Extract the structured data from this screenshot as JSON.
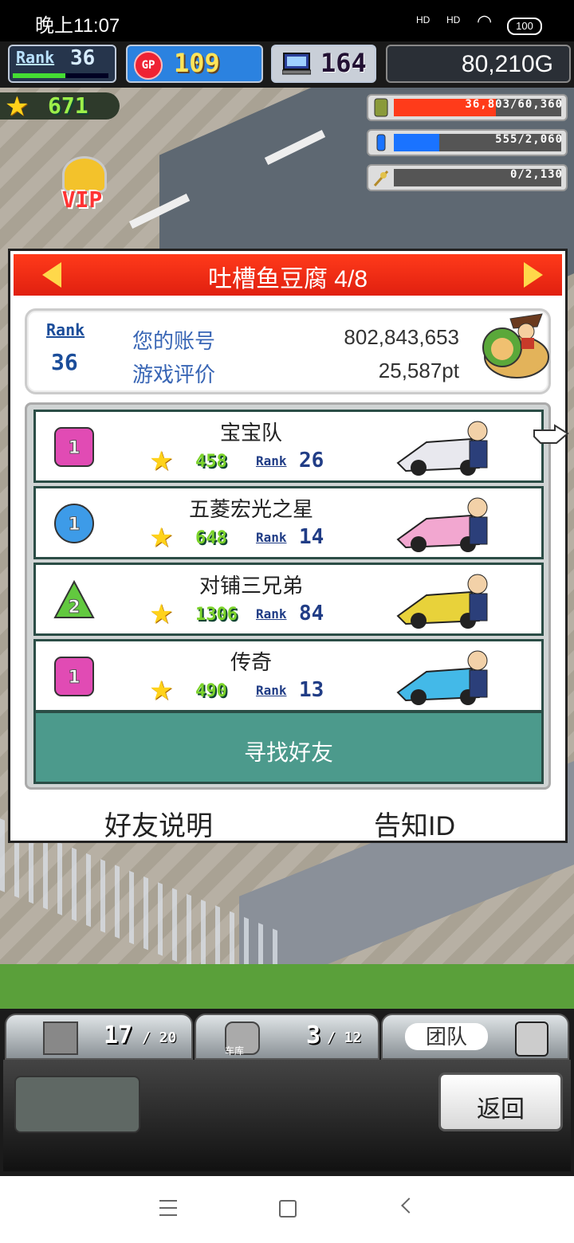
{
  "status_bar": {
    "time": "晚上11:07",
    "signal1": "HD",
    "signal2": "HD",
    "battery": "100"
  },
  "hud": {
    "rank_label": "Rank",
    "rank_value": "36",
    "rank_progress": 0.55,
    "gp_icon": "GP",
    "gp_value": "109",
    "pc_value": "164",
    "money": "80,210G"
  },
  "scene": {
    "score": "671",
    "vip": "VIP",
    "resources": [
      {
        "icon": "barrel-icon",
        "text": "36,803/60,360",
        "fill": 0.61,
        "color": "#ff3b1a"
      },
      {
        "icon": "bottle-icon",
        "text": "555/2,060",
        "fill": 0.27,
        "color": "#1a73ff"
      },
      {
        "icon": "wheat-icon",
        "text": "0/2,130",
        "fill": 0,
        "color": "#7ad13a"
      }
    ]
  },
  "dialog": {
    "title": "吐槽鱼豆腐 4/8",
    "account": {
      "rank_label": "Rank",
      "rank_value": "36",
      "id_label": "您的账号",
      "id_value": "802,843,653",
      "eval_label": "游戏评价",
      "eval_value": "25,587pt"
    },
    "friends": [
      {
        "badge": "1",
        "badge_shape": "square",
        "badge_color": "#e14bb4",
        "name": "宝宝队",
        "stars": "458",
        "rank_label": "Rank",
        "rank": "26",
        "car_color": "#e8e8ee"
      },
      {
        "badge": "1",
        "badge_shape": "circle",
        "badge_color": "#3d9be8",
        "name": "五菱宏光之星",
        "stars": "648",
        "rank_label": "Rank",
        "rank": "14",
        "car_color": "#f2a7d0"
      },
      {
        "badge": "2",
        "badge_shape": "triangle",
        "badge_color": "#62c93f",
        "name": "对铺三兄弟",
        "stars": "1306",
        "rank_label": "Rank",
        "rank": "84",
        "car_color": "#e8d23a"
      },
      {
        "badge": "1",
        "badge_shape": "square",
        "badge_color": "#e14bb4",
        "name": "传奇",
        "stars": "490",
        "rank_label": "Rank",
        "rank": "13",
        "car_color": "#43b9e8"
      }
    ],
    "find_friend": "寻找好友",
    "friend_help": "好友说明",
    "tell_id": "告知ID"
  },
  "bottom": {
    "stock_value": "17",
    "stock_max": "/ 20",
    "garage_label": "车库",
    "garage_value": "3",
    "garage_max": "/ 12",
    "team_label": "团队",
    "back": "返回"
  }
}
